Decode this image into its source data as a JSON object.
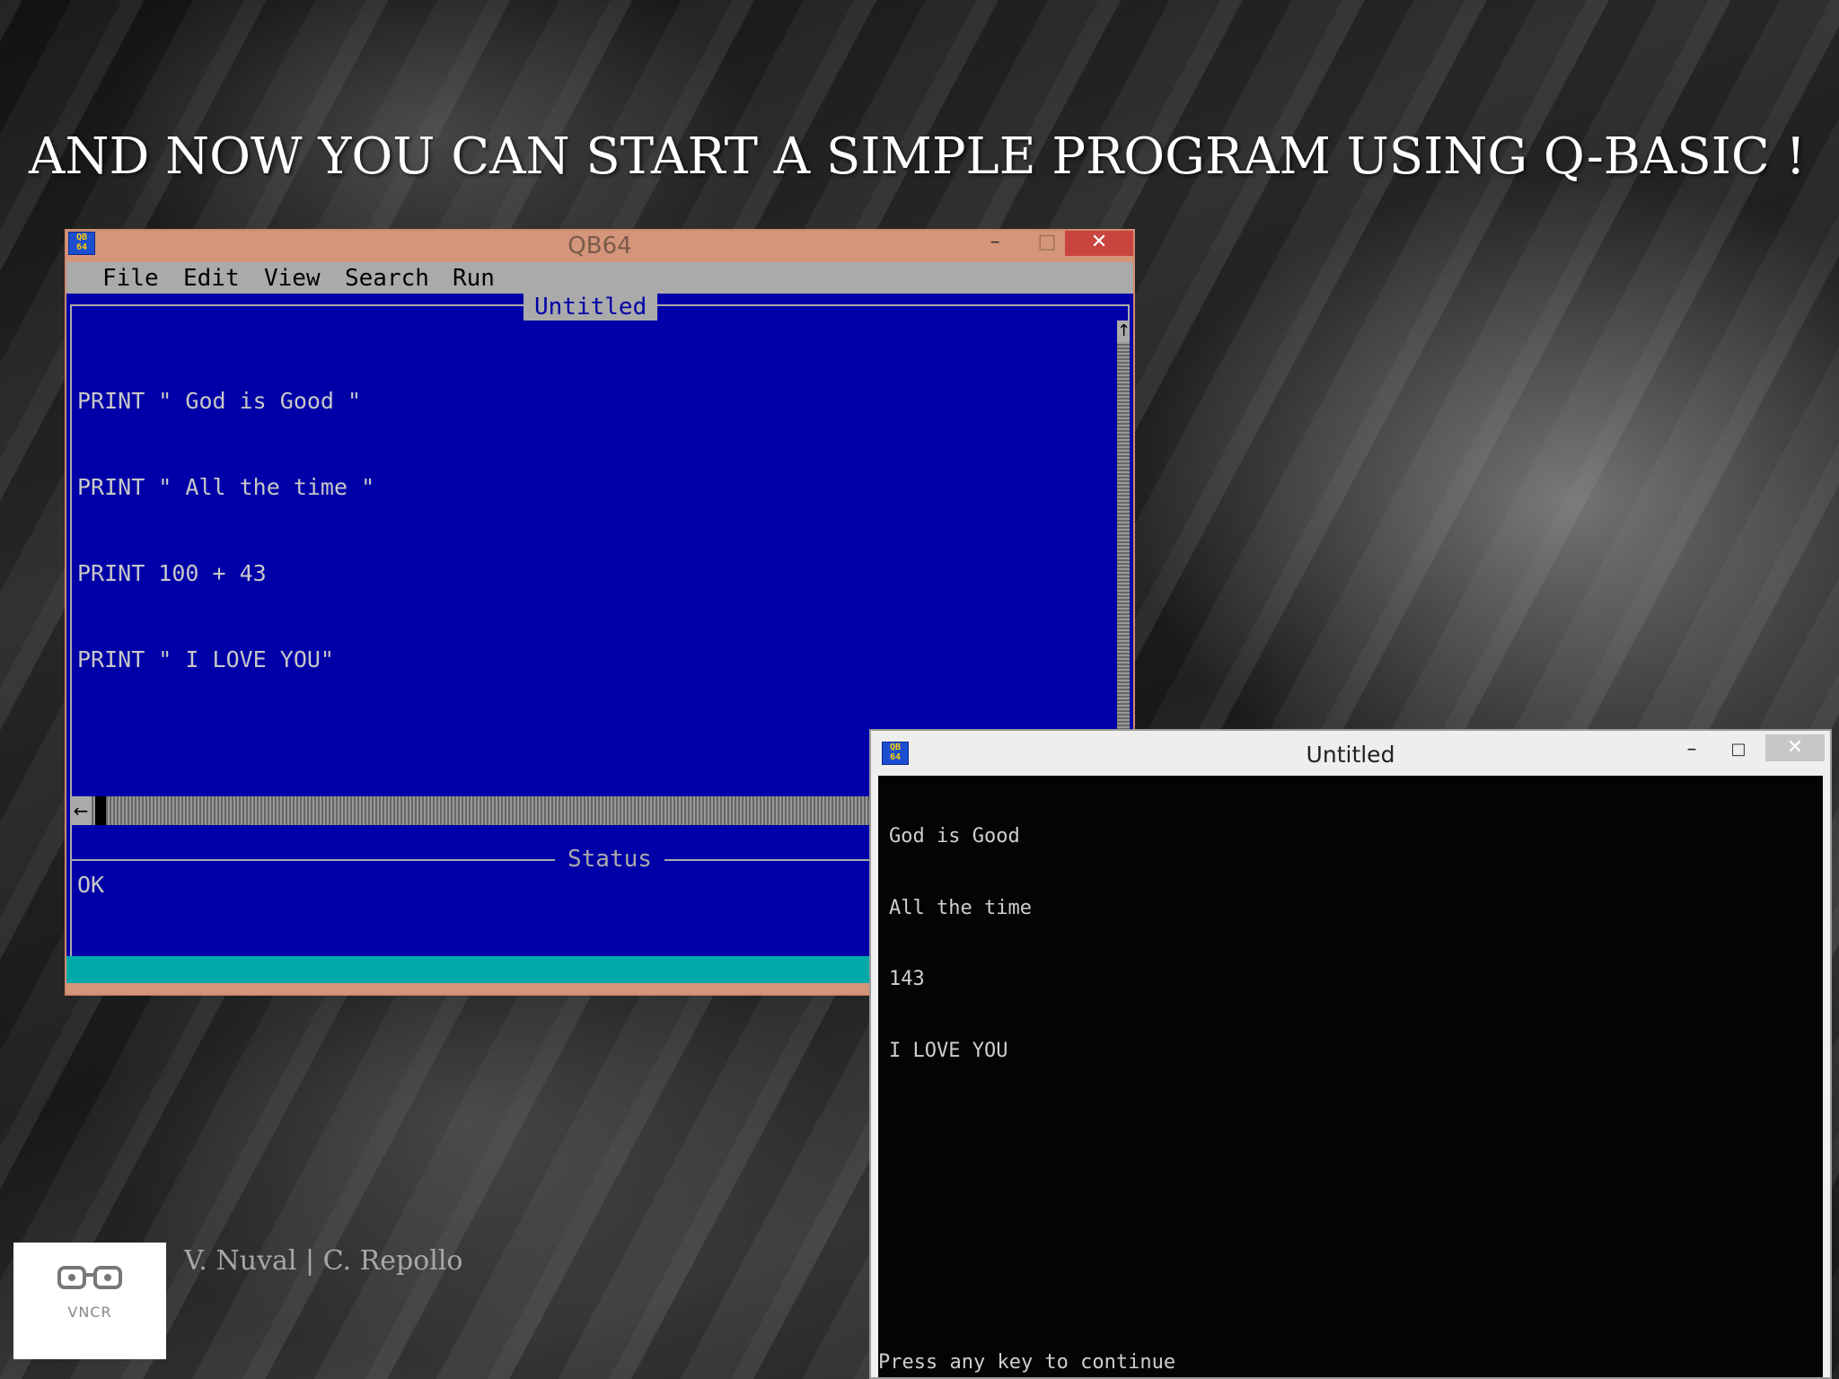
{
  "slide": {
    "title": "AND NOW YOU CAN START A SIMPLE PROGRAM USING Q-BASIC !",
    "credits": "V. Nuval | C. Repollo",
    "logo_text": "VNCR"
  },
  "qb_window": {
    "title": "QB64",
    "icon_label": "QB\n64",
    "menu": [
      "File",
      "Edit",
      "View",
      "Search",
      "Run"
    ],
    "editor_tab": "Untitled",
    "code_lines": [
      "PRINT \" God is Good \"",
      "PRINT \" All the time \"",
      "PRINT 100 + 43",
      "PRINT \" I LOVE YOU\""
    ],
    "status_label": "Status",
    "status_text": "OK",
    "close_glyph": "✕",
    "minimize_glyph": "–",
    "maximize_glyph": "□"
  },
  "output_window": {
    "title": "Untitled",
    "output_lines": [
      "God is Good",
      "All the time",
      "143",
      "I LOVE YOU"
    ],
    "footer": "Press any key to continue",
    "close_glyph": "✕",
    "minimize_glyph": "–",
    "maximize_glyph": "□"
  },
  "colors": {
    "qb_editor_bg": "#0000a8",
    "qb_titlebar": "#d4957a",
    "qb_menubar": "#aaaaaa",
    "qb_status_bar": "#00aaaa",
    "close_button": "#c8453f"
  }
}
